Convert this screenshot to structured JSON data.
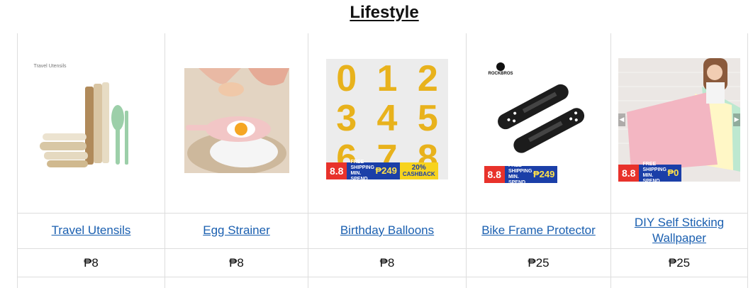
{
  "section": {
    "title": "Lifestyle"
  },
  "products": [
    {
      "name": "Travel Utensils",
      "price": "₱8",
      "image_icon": "travel-utensils-image",
      "brand_mark": "Travel Utensils"
    },
    {
      "name": "Egg Strainer",
      "price": "₱8",
      "image_icon": "egg-strainer-image"
    },
    {
      "name": "Birthday Balloons",
      "price": "₱8",
      "image_icon": "birthday-balloons-image",
      "balloon_digits": [
        "0",
        "1",
        "2",
        "3",
        "4",
        "5",
        "6",
        "7",
        "8"
      ],
      "badge": {
        "sale": "8.8",
        "shipping": "FREE SHIPPING MIN. SPEND",
        "amount": "₱249",
        "cashback_pct": "20%",
        "cashback": "CASHBACK"
      }
    },
    {
      "name": "Bike Frame Protector",
      "price": "₱25",
      "image_icon": "bike-frame-protector-image",
      "brand": "ROCKBROS",
      "badge": {
        "sale": "8.8",
        "shipping": "FREE SHIPPING MIN. SPEND",
        "amount": "₱249"
      }
    },
    {
      "name": "DIY Self Sticking Wallpaper",
      "price": "₱25",
      "image_icon": "wallpaper-image",
      "badge": {
        "sale": "8.8",
        "shipping": "FREE SHIPPING MIN. SPEND",
        "amount": "₱0"
      }
    }
  ],
  "colors": {
    "link": "#1a5fb0",
    "border": "#dddddd",
    "badge_red": "#e8322b",
    "badge_blue": "#1b3fa8",
    "badge_yellow": "#f7d31e",
    "balloon_gold": "#e8b21c"
  }
}
